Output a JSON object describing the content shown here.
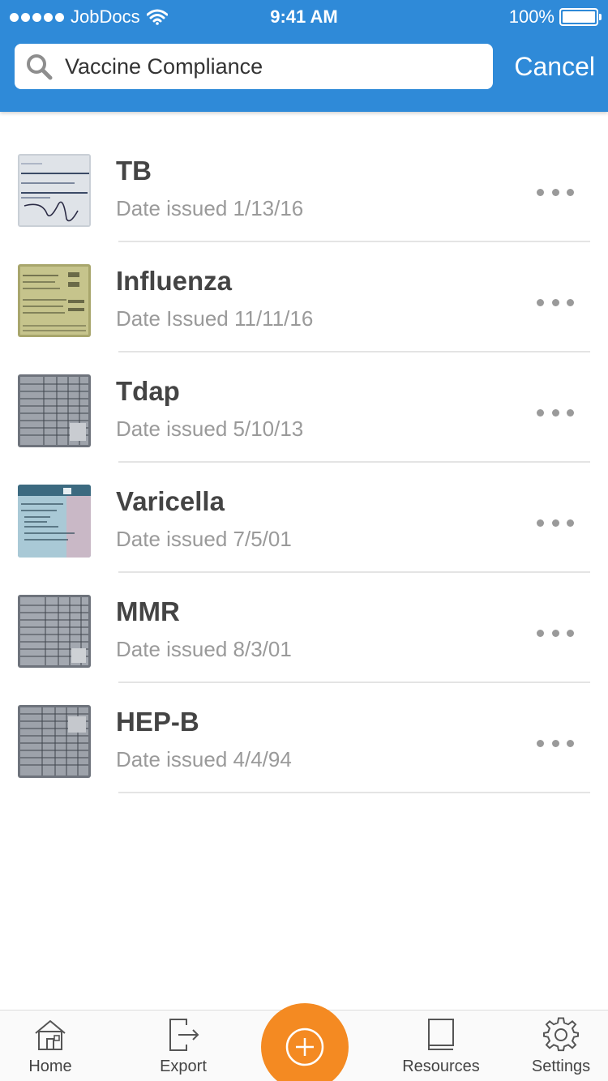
{
  "status_bar": {
    "carrier": "JobDocs",
    "time": "9:41 AM",
    "battery": "100%"
  },
  "search": {
    "value": "Vaccine Compliance",
    "placeholder": "Search",
    "cancel_label": "Cancel"
  },
  "documents": [
    {
      "title": "TB",
      "date": "Date issued 1/13/16",
      "thumb": "signed-form"
    },
    {
      "title": "Influenza",
      "date": "Date Issued 11/11/16",
      "thumb": "yellow-form"
    },
    {
      "title": "Tdap",
      "date": "Date issued 5/10/13",
      "thumb": "grid-record"
    },
    {
      "title": "Varicella",
      "date": "Date issued 7/5/01",
      "thumb": "printed-record"
    },
    {
      "title": "MMR",
      "date": "Date issued 8/3/01",
      "thumb": "grid-record"
    },
    {
      "title": "HEP-B",
      "date": "Date issued 4/4/94",
      "thumb": "grid-record"
    }
  ],
  "tab_bar": {
    "home": "Home",
    "export": "Export",
    "resources": "Resources",
    "settings": "Settings"
  },
  "colors": {
    "header": "#2f8ad8",
    "accent": "#f48a22",
    "title_text": "#444444",
    "secondary_text": "#9a9a9a"
  },
  "icons": {
    "search": "search-icon",
    "more": "more-icon",
    "add": "add-icon",
    "home": "home-icon",
    "export": "export-icon",
    "resources": "book-icon",
    "settings": "gear-icon"
  }
}
